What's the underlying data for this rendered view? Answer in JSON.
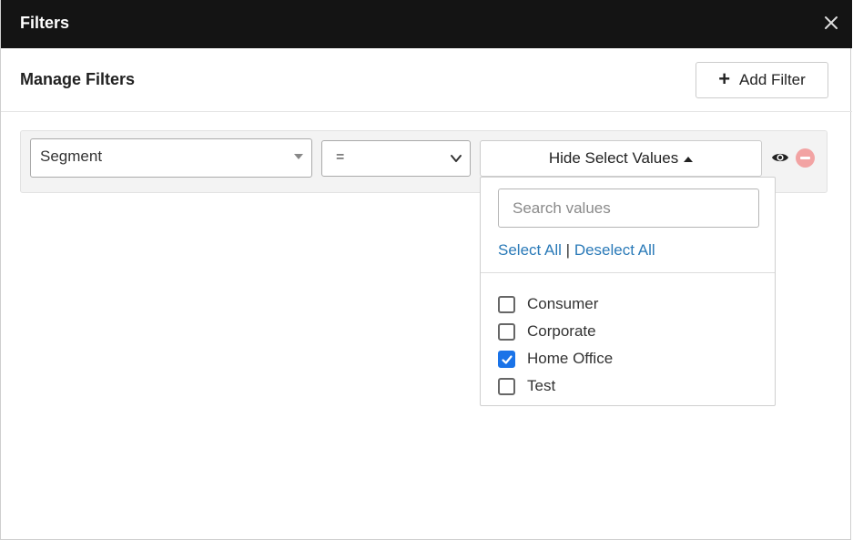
{
  "modal": {
    "title": "Filters",
    "close_icon": "close-icon"
  },
  "header": {
    "title": "Manage Filters",
    "add_filter_label": "Add Filter",
    "add_filter_icon": "plus-icon"
  },
  "filter": {
    "field_value": "Segment",
    "operator_value": "=",
    "values_toggle_label": "Hide Select Values",
    "visibility_icon": "eye-icon",
    "remove_icon": "minus-circle-icon"
  },
  "dropdown": {
    "search_placeholder": "Search values",
    "select_all_label": "Select All",
    "separator": "|",
    "deselect_all_label": "Deselect All",
    "options": [
      {
        "label": "Consumer",
        "checked": false
      },
      {
        "label": "Corporate",
        "checked": false
      },
      {
        "label": "Home Office",
        "checked": true
      },
      {
        "label": "Test",
        "checked": false
      }
    ]
  },
  "colors": {
    "titlebar": "#141414",
    "link": "#2a7ab8",
    "checkbox_checked": "#1a73e8",
    "remove_icon": "#f2a3a3"
  }
}
